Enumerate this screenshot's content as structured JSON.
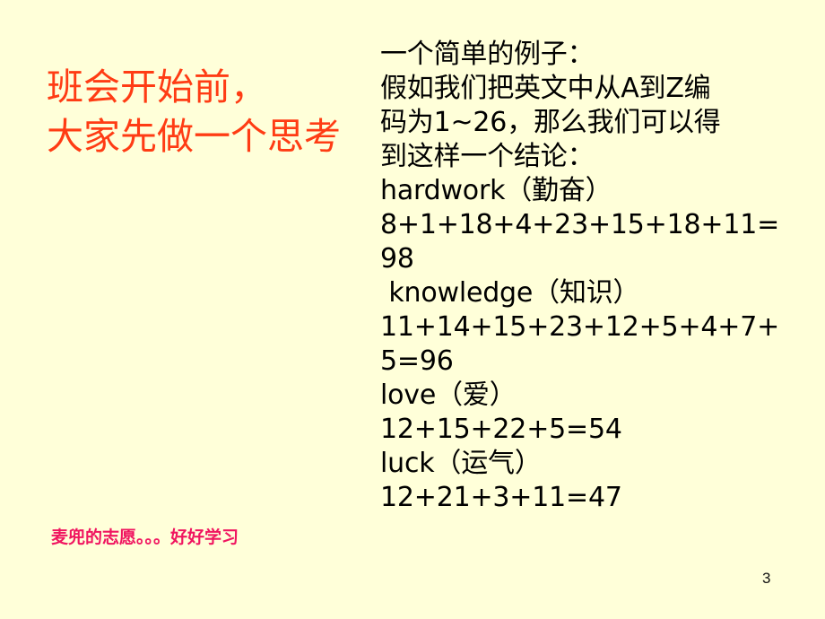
{
  "slide": {
    "background_color": "#ffffd9",
    "number": "3"
  },
  "title": {
    "color": "#ff3c14",
    "lines": [
      "班会开始前，",
      "大家先做一个思考"
    ]
  },
  "subtitle": {
    "color": "#f01560",
    "text": "麦兜的志愿。。。好好学习"
  },
  "body": {
    "color": "#000000",
    "lines": [
      "一个简单的例子：",
      "假如我们把英文中从A到Z编",
      "码为1~26，那么我们可以得",
      "到这样一个结论：",
      "hardwork（勤奋）",
      "8+1+18+4+23+15+18+11=",
      "98",
      " knowledge（知识）",
      "11+14+15+23+12+5+4+7+",
      "5=96",
      "love（爱）",
      "12+15+22+5=54",
      "luck（运气）",
      "12+21+3+11=47"
    ]
  }
}
